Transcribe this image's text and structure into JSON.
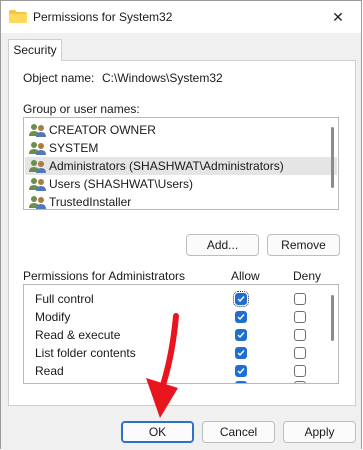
{
  "window": {
    "title": "Permissions for System32"
  },
  "tabs": [
    {
      "label": "Security"
    }
  ],
  "object": {
    "label": "Object name:",
    "value": "C:\\Windows\\System32"
  },
  "groups": {
    "label": "Group or user names:",
    "items": [
      {
        "label": "CREATOR OWNER",
        "selected": false
      },
      {
        "label": "SYSTEM",
        "selected": false
      },
      {
        "label": "Administrators (SHASHWAT\\Administrators)",
        "selected": true
      },
      {
        "label": "Users (SHASHWAT\\Users)",
        "selected": false
      },
      {
        "label": "TrustedInstaller",
        "selected": false
      }
    ]
  },
  "buttons": {
    "add": "Add...",
    "remove": "Remove",
    "ok": "OK",
    "cancel": "Cancel",
    "apply": "Apply"
  },
  "permissions": {
    "label": "Permissions for Administrators",
    "allow_label": "Allow",
    "deny_label": "Deny",
    "items": [
      {
        "label": "Full control",
        "allow": true,
        "deny": false
      },
      {
        "label": "Modify",
        "allow": true,
        "deny": false
      },
      {
        "label": "Read & execute",
        "allow": true,
        "deny": false
      },
      {
        "label": "List folder contents",
        "allow": true,
        "deny": false
      },
      {
        "label": "Read",
        "allow": true,
        "deny": false
      },
      {
        "label": "",
        "allow": true,
        "deny": false
      }
    ]
  },
  "colors": {
    "accent": "#1f6fd1",
    "annotation_arrow": "#e8141e"
  }
}
